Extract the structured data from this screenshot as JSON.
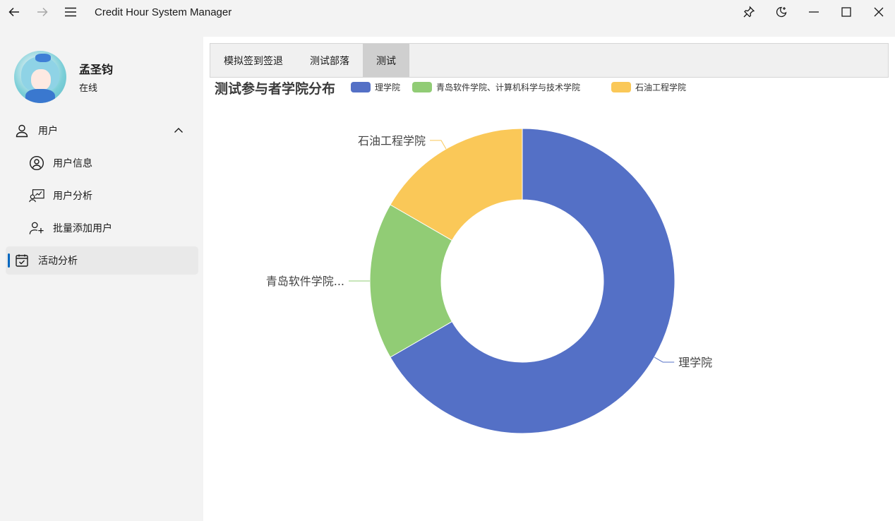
{
  "window": {
    "title": "Credit Hour System Manager"
  },
  "profile": {
    "name": "孟圣钧",
    "status": "在线"
  },
  "nav": {
    "users_label": "用户",
    "user_info_label": "用户信息",
    "user_analysis_label": "用户分析",
    "batch_add_label": "批量添加用户",
    "activity_label": "活动分析"
  },
  "tabs": [
    {
      "label": "模拟签到签退"
    },
    {
      "label": "测试部落"
    },
    {
      "label": "测试"
    }
  ],
  "colors": {
    "accent": "#0067c0",
    "series_1": "#5470c6",
    "series_2": "#91cc75",
    "series_3": "#fac858"
  },
  "chart_data": {
    "type": "pie",
    "title": "测试参与者学院分布",
    "donut": true,
    "legend_position": "top",
    "categories": [
      "理学院",
      "青岛软件学院、计算机科学与技术学院",
      "石油工程学院"
    ],
    "display_labels": [
      "理学院",
      "青岛软件学院...",
      "石油工程学院"
    ],
    "values": [
      4,
      1,
      1
    ]
  }
}
